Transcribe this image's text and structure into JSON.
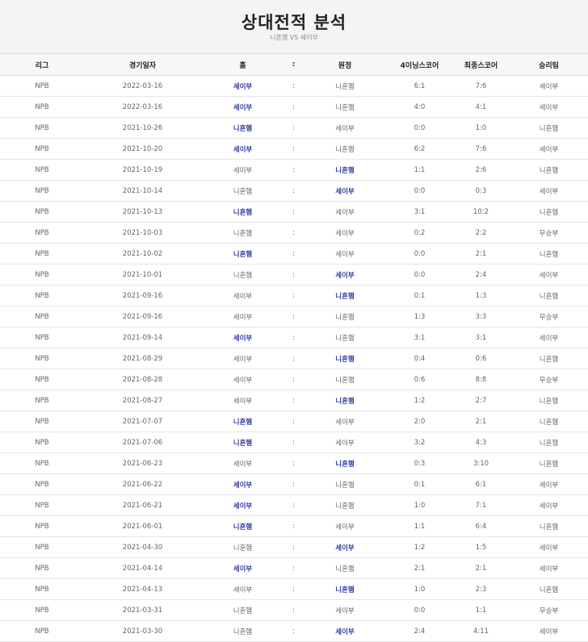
{
  "page": {
    "title": "상대전적 분석",
    "subtitle": "니혼햄 VS 세이부"
  },
  "table": {
    "headers": {
      "league": "리그",
      "date": "경기일자",
      "home": "홈",
      "sep": ":",
      "away": "원정",
      "inning4": "4이닝스코어",
      "final": "최종스코어",
      "winner": "승리팀"
    },
    "rows": [
      {
        "league": "NPB",
        "date": "2022-03-16",
        "home": "세이부",
        "sep": ":",
        "away": "니혼햄",
        "inning4": "6:1",
        "final": "7:6",
        "winner": "세이부",
        "win_side": "home"
      },
      {
        "league": "NPB",
        "date": "2022-03-16",
        "home": "세이부",
        "sep": ":",
        "away": "니혼햄",
        "inning4": "4:0",
        "final": "4:1",
        "winner": "세이부",
        "win_side": "home"
      },
      {
        "league": "NPB",
        "date": "2021-10-26",
        "home": "니혼햄",
        "sep": ":",
        "away": "세이부",
        "inning4": "0:0",
        "final": "1:0",
        "winner": "니혼햄",
        "win_side": "home"
      },
      {
        "league": "NPB",
        "date": "2021-10-20",
        "home": "세이부",
        "sep": ":",
        "away": "니혼햄",
        "inning4": "6:2",
        "final": "7:6",
        "winner": "세이부",
        "win_side": "home"
      },
      {
        "league": "NPB",
        "date": "2021-10-19",
        "home": "세이부",
        "sep": ":",
        "away": "니혼햄",
        "inning4": "1:1",
        "final": "2:6",
        "winner": "니혼햄",
        "win_side": "away"
      },
      {
        "league": "NPB",
        "date": "2021-10-14",
        "home": "니혼햄",
        "sep": ":",
        "away": "세이부",
        "inning4": "0:0",
        "final": "0:3",
        "winner": "세이부",
        "win_side": "away"
      },
      {
        "league": "NPB",
        "date": "2021-10-13",
        "home": "니혼햄",
        "sep": ":",
        "away": "세이부",
        "inning4": "3:1",
        "final": "10:2",
        "winner": "니혼햄",
        "win_side": "home"
      },
      {
        "league": "NPB",
        "date": "2021-10-03",
        "home": "니혼햄",
        "sep": ":",
        "away": "세이부",
        "inning4": "0:2",
        "final": "2:2",
        "winner": "무승부",
        "win_side": "none"
      },
      {
        "league": "NPB",
        "date": "2021-10-02",
        "home": "니혼햄",
        "sep": ":",
        "away": "세이부",
        "inning4": "0:0",
        "final": "2:1",
        "winner": "니혼햄",
        "win_side": "home"
      },
      {
        "league": "NPB",
        "date": "2021-10-01",
        "home": "니혼햄",
        "sep": ":",
        "away": "세이부",
        "inning4": "0:0",
        "final": "2:4",
        "winner": "세이부",
        "win_side": "away"
      },
      {
        "league": "NPB",
        "date": "2021-09-16",
        "home": "세이부",
        "sep": ":",
        "away": "니혼햄",
        "inning4": "0:1",
        "final": "1:3",
        "winner": "니혼햄",
        "win_side": "away"
      },
      {
        "league": "NPB",
        "date": "2021-09-16",
        "home": "세이부",
        "sep": ":",
        "away": "니혼햄",
        "inning4": "1:3",
        "final": "3:3",
        "winner": "무승부",
        "win_side": "none"
      },
      {
        "league": "NPB",
        "date": "2021-09-14",
        "home": "세이부",
        "sep": ":",
        "away": "니혼햄",
        "inning4": "3:1",
        "final": "3:1",
        "winner": "세이부",
        "win_side": "home"
      },
      {
        "league": "NPB",
        "date": "2021-08-29",
        "home": "세이부",
        "sep": ":",
        "away": "니혼햄",
        "inning4": "0:4",
        "final": "0:6",
        "winner": "니혼햄",
        "win_side": "away"
      },
      {
        "league": "NPB",
        "date": "2021-08-28",
        "home": "세이부",
        "sep": ":",
        "away": "니혼햄",
        "inning4": "0:6",
        "final": "8:8",
        "winner": "무승부",
        "win_side": "none"
      },
      {
        "league": "NPB",
        "date": "2021-08-27",
        "home": "세이부",
        "sep": ":",
        "away": "니혼햄",
        "inning4": "1:2",
        "final": "2:7",
        "winner": "니혼햄",
        "win_side": "away"
      },
      {
        "league": "NPB",
        "date": "2021-07-07",
        "home": "니혼햄",
        "sep": ":",
        "away": "세이부",
        "inning4": "2:0",
        "final": "2:1",
        "winner": "니혼햄",
        "win_side": "home"
      },
      {
        "league": "NPB",
        "date": "2021-07-06",
        "home": "니혼햄",
        "sep": ":",
        "away": "세이부",
        "inning4": "3:2",
        "final": "4:3",
        "winner": "니혼햄",
        "win_side": "home"
      },
      {
        "league": "NPB",
        "date": "2021-06-23",
        "home": "세이부",
        "sep": ":",
        "away": "니혼햄",
        "inning4": "0:3",
        "final": "3:10",
        "winner": "니혼햄",
        "win_side": "away"
      },
      {
        "league": "NPB",
        "date": "2021-06-22",
        "home": "세이부",
        "sep": ":",
        "away": "니혼햄",
        "inning4": "0:1",
        "final": "6:1",
        "winner": "세이부",
        "win_side": "home"
      },
      {
        "league": "NPB",
        "date": "2021-06-21",
        "home": "세이부",
        "sep": ":",
        "away": "니혼햄",
        "inning4": "1:0",
        "final": "7:1",
        "winner": "세이부",
        "win_side": "home"
      },
      {
        "league": "NPB",
        "date": "2021-06-01",
        "home": "니혼햄",
        "sep": ":",
        "away": "세이부",
        "inning4": "1:1",
        "final": "6:4",
        "winner": "니혼햄",
        "win_side": "home"
      },
      {
        "league": "NPB",
        "date": "2021-04-30",
        "home": "니혼햄",
        "sep": ":",
        "away": "세이부",
        "inning4": "1:2",
        "final": "1:5",
        "winner": "세이부",
        "win_side": "away"
      },
      {
        "league": "NPB",
        "date": "2021-04-14",
        "home": "세이부",
        "sep": ":",
        "away": "니혼햄",
        "inning4": "2:1",
        "final": "2:1",
        "winner": "세이부",
        "win_side": "home"
      },
      {
        "league": "NPB",
        "date": "2021-04-13",
        "home": "세이부",
        "sep": ":",
        "away": "니혼햄",
        "inning4": "1:0",
        "final": "2:3",
        "winner": "니혼햄",
        "win_side": "away"
      },
      {
        "league": "NPB",
        "date": "2021-03-31",
        "home": "니혼햄",
        "sep": ":",
        "away": "세이부",
        "inning4": "0:0",
        "final": "1:1",
        "winner": "무승부",
        "win_side": "none"
      },
      {
        "league": "NPB",
        "date": "2021-03-30",
        "home": "니혼햄",
        "sep": ":",
        "away": "세이부",
        "inning4": "2:4",
        "final": "4:11",
        "winner": "세이부",
        "win_side": "away"
      }
    ]
  },
  "colors": {
    "winner_team": "#2f3aa0",
    "header_bg": "#f3f4f6",
    "text": "#666666"
  }
}
